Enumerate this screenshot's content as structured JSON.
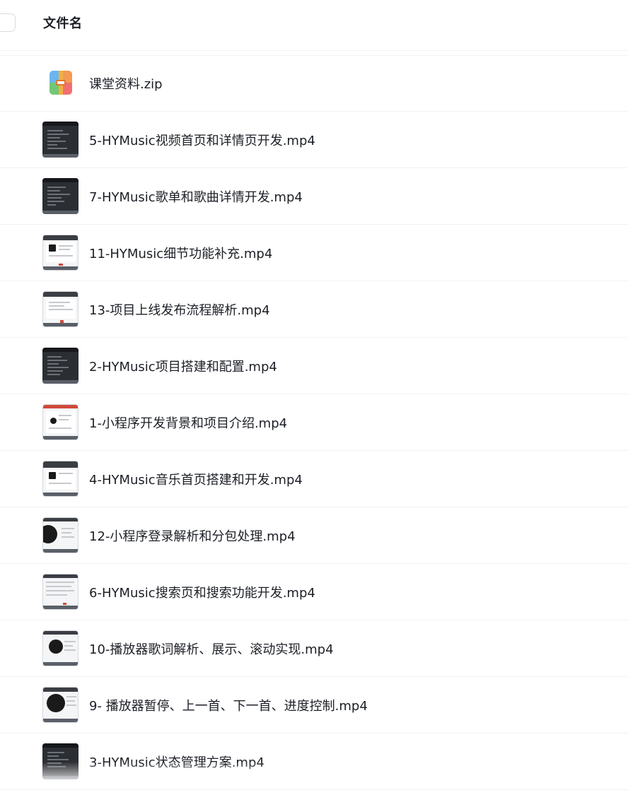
{
  "header": {
    "column_title": "文件名"
  },
  "files": [
    {
      "name": "课堂资料.zip",
      "icon": "zip-archive-icon",
      "thumb": "zip"
    },
    {
      "name": "5-HYMusic视频首页和详情页开发.mp4",
      "icon": "video-thumbnail",
      "thumb": "dark"
    },
    {
      "name": "7-HYMusic歌单和歌曲详情开发.mp4",
      "icon": "video-thumbnail",
      "thumb": "dark"
    },
    {
      "name": "11-HYMusic细节功能补充.mp4",
      "icon": "video-thumbnail",
      "thumb": "light"
    },
    {
      "name": "13-项目上线发布流程解析.mp4",
      "icon": "video-thumbnail",
      "thumb": "light"
    },
    {
      "name": "2-HYMusic项目搭建和配置.mp4",
      "icon": "video-thumbnail",
      "thumb": "dark"
    },
    {
      "name": "1-小程序开发背景和项目介绍.mp4",
      "icon": "video-thumbnail",
      "thumb": "light"
    },
    {
      "name": "4-HYMusic音乐首页搭建和开发.mp4",
      "icon": "video-thumbnail",
      "thumb": "light"
    },
    {
      "name": "12-小程序登录解析和分包处理.mp4",
      "icon": "video-thumbnail",
      "thumb": "light"
    },
    {
      "name": "6-HYMusic搜索页和搜索功能开发.mp4",
      "icon": "video-thumbnail",
      "thumb": "light"
    },
    {
      "name": "10-播放器歌词解析、展示、滚动实现.mp4",
      "icon": "video-thumbnail",
      "thumb": "light"
    },
    {
      "name": "9- 播放器暂停、上一首、下一首、进度控制.mp4",
      "icon": "video-thumbnail",
      "thumb": "light"
    },
    {
      "name": "3-HYMusic状态管理方案.mp4",
      "icon": "video-thumbnail",
      "thumb": "dark"
    }
  ]
}
